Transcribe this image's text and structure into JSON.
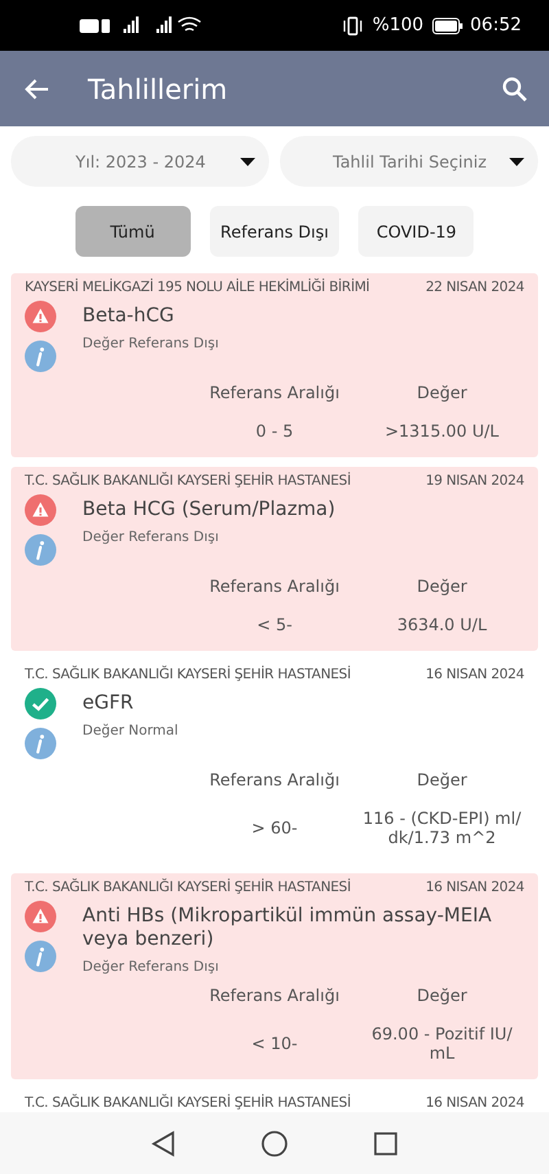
{
  "status_bar": {
    "battery": "%100",
    "time": "06:52"
  },
  "header": {
    "title": "Tahlillerim"
  },
  "filters": [
    {
      "label": "Yıl: 2023 - 2024"
    },
    {
      "label": "Tahlil Tarihi Seçiniz"
    }
  ],
  "chips": [
    {
      "label": "Tümü",
      "selected": true
    },
    {
      "label": "Referans Dışı",
      "selected": false
    },
    {
      "label": "COVID-19",
      "selected": false
    }
  ],
  "results": [
    {
      "kind": "abnormal",
      "institution": "KAYSERİ MELİKGAZİ 195 NOLU AİLE HEKİMLİĞİ BİRİMİ",
      "date": "22 NISAN 2024",
      "test": "Beta-hCG",
      "status": "Değer Referans Dışı",
      "range_label": "Referans Aralığı",
      "value_label": "Değer",
      "range": "0 - 5",
      "value": ">1315.00 U/L"
    },
    {
      "kind": "abnormal",
      "institution": "T.C. SAĞLIK BAKANLIĞI KAYSERİ ŞEHİR HASTANESİ",
      "date": "19 NISAN 2024",
      "test": "Beta HCG (Serum/Plazma)",
      "status": "Değer Referans Dışı",
      "range_label": "Referans Aralığı",
      "value_label": "Değer",
      "range": "< 5-",
      "value": "3634.0 U/L"
    },
    {
      "kind": "normal",
      "institution": "T.C. SAĞLIK BAKANLIĞI KAYSERİ ŞEHİR HASTANESİ",
      "date": "16 NISAN 2024",
      "test": "eGFR",
      "status": "Değer Normal",
      "range_label": "Referans Aralığı",
      "value_label": "Değer",
      "range": "> 60-",
      "value": "116 - (CKD-EPI) ml/ dk/1.73 m^2"
    },
    {
      "kind": "abnormal",
      "institution": "T.C. SAĞLIK BAKANLIĞI KAYSERİ ŞEHİR HASTANESİ",
      "date": "16 NISAN 2024",
      "test": "Anti HBs  (Mikropartikül immün assay-MEIA veya benzeri)",
      "status": "Değer Referans Dışı",
      "range_label": "Referans Aralığı",
      "value_label": "Değer",
      "range": "< 10-",
      "value": "69.00 - Pozitif IU/ mL"
    },
    {
      "kind": "normal",
      "institution": "T.C. SAĞLIK BAKANLIĞI KAYSERİ ŞEHİR HASTANESİ",
      "date": "16 NISAN 2024"
    }
  ]
}
